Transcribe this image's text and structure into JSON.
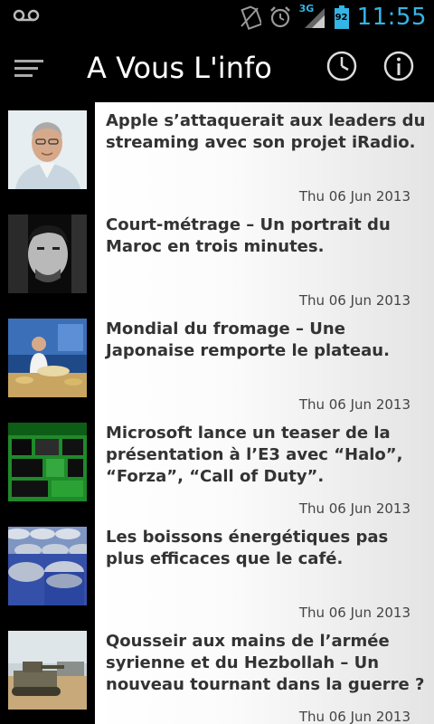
{
  "status_bar": {
    "network_type": "3G",
    "battery_level": "92",
    "time": "11:55",
    "icons": [
      "voicemail-icon",
      "no-sim-icon",
      "alarm-icon",
      "signal-icon",
      "battery-icon"
    ],
    "accent_color": "#33b5e5"
  },
  "action_bar": {
    "title": "A Vous L'info",
    "icons": [
      "menu-icon",
      "clock-icon",
      "info-icon"
    ]
  },
  "news": [
    {
      "headline": "Apple s’attaquerait aux leaders du streaming avec son projet iRadio.",
      "date": "Thu 06 Jun 2013"
    },
    {
      "headline": "Court-métrage – Un portrait du Maroc en trois minutes.",
      "date": "Thu 06 Jun 2013"
    },
    {
      "headline": "Mondial du fromage – Une Japonaise remporte le plateau.",
      "date": "Thu 06 Jun 2013"
    },
    {
      "headline": "Microsoft lance un teaser de la présentation à l’E3 avec “Halo”, “Forza”, “Call of Duty”.",
      "date": "Thu 06 Jun 2013"
    },
    {
      "headline": "Les boissons énergétiques pas plus efficaces que le café.",
      "date": "Thu 06 Jun 2013"
    },
    {
      "headline": "Qousseir aux mains de l’armée syrienne et du Hezbollah – Un nouveau tournant dans la guerre ?",
      "date": "Thu 06 Jun 2013"
    }
  ]
}
